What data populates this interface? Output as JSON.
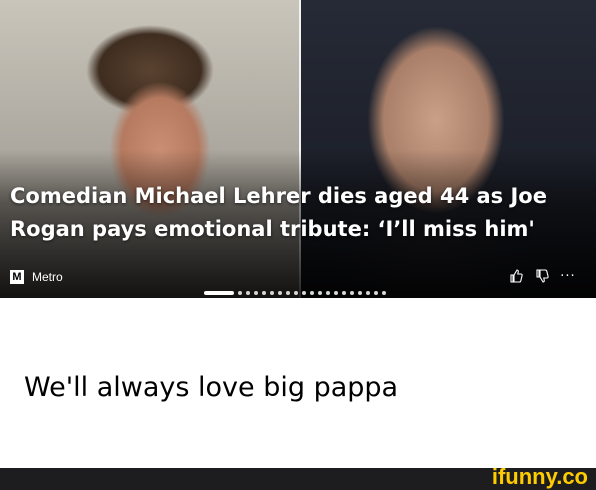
{
  "article": {
    "headline_line1": "Comedian Michael Lehrer dies aged 44 as Joe",
    "headline_line2": "Rogan pays emotional tribute: ‘I’ll miss him'",
    "source": {
      "logo_letter": "M",
      "name": "Metro"
    },
    "actions": {
      "like_icon": "thumbs-up-icon",
      "dislike_icon": "thumbs-down-icon",
      "more_label": "···"
    },
    "pager": {
      "total": 20,
      "current": 1
    }
  },
  "caption": "We'll always love big pappa",
  "watermark": "ifunny.co",
  "colors": {
    "watermark": "#ffcc00",
    "footer": "#1d1d1f"
  }
}
